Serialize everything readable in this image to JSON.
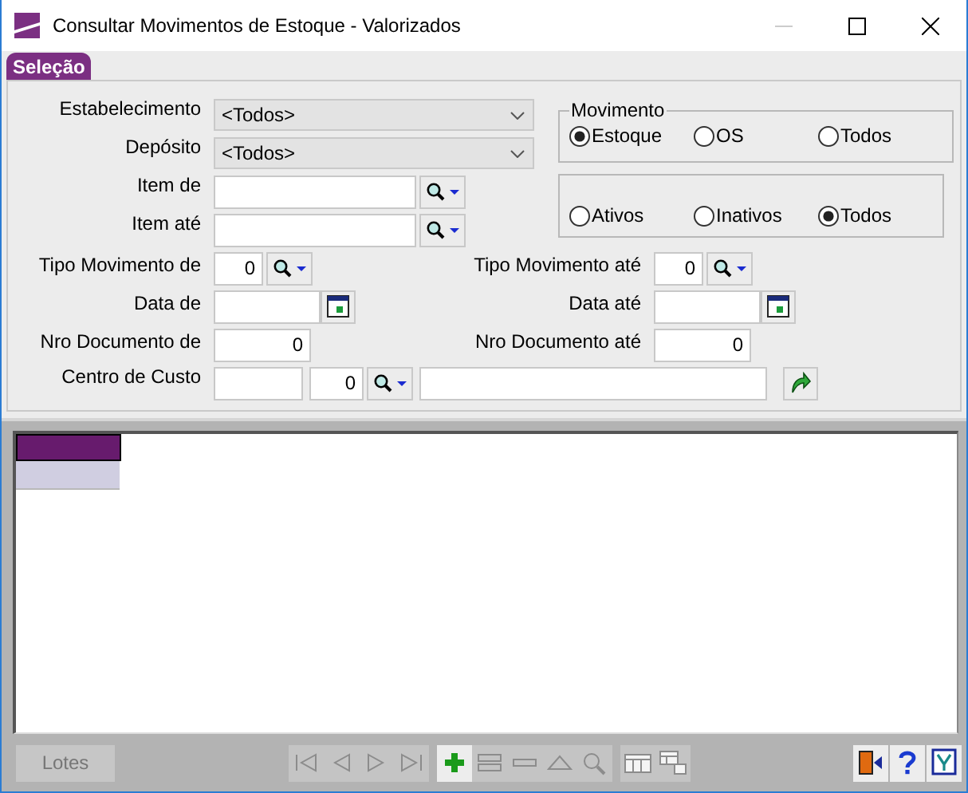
{
  "window": {
    "title": "Consultar Movimentos de Estoque - Valorizados",
    "minimize_disabled": true
  },
  "tabs": [
    {
      "label": "Seleção",
      "selected": true
    }
  ],
  "estabelecimento": {
    "label": "Estabelecimento",
    "value": "<Todos>"
  },
  "deposito": {
    "label": "Depósito",
    "value": "<Todos>"
  },
  "item_de": {
    "label": "Item de"
  },
  "item_ate": {
    "label": "Item até"
  },
  "movimento": {
    "legend": "Movimento",
    "options": [
      {
        "label": "Estoque",
        "selected": true
      },
      {
        "label": "OS",
        "selected": false
      },
      {
        "label": "Todos",
        "selected": false
      }
    ]
  },
  "situacao": {
    "options": [
      {
        "label": "Ativos",
        "selected": false
      },
      {
        "label": "Inativos",
        "selected": false
      },
      {
        "label": "Todos",
        "selected": true
      }
    ]
  },
  "tipo_movimento_de": {
    "label": "Tipo Movimento de",
    "value": "0"
  },
  "tipo_movimento_ate": {
    "label": "Tipo Movimento até",
    "value": "0"
  },
  "data_de": {
    "label": "Data de"
  },
  "data_ate": {
    "label": "Data até"
  },
  "nro_documento_de": {
    "label": "Nro Documento de",
    "value": "0"
  },
  "nro_documento_ate": {
    "label": "Nro Documento até",
    "value": "0"
  },
  "centro_de_custo": {
    "label": "Centro de Custo",
    "number": "0"
  },
  "lotes_button": {
    "label": "Lotes",
    "disabled": true
  },
  "toolbar": [
    {
      "kind": "first",
      "disabled": true
    },
    {
      "kind": "prev",
      "disabled": true
    },
    {
      "kind": "next",
      "disabled": true
    },
    {
      "kind": "last",
      "disabled": true
    },
    {
      "kind": "add",
      "disabled": false
    },
    {
      "kind": "edit",
      "disabled": true
    },
    {
      "kind": "delete",
      "disabled": true
    },
    {
      "kind": "up",
      "disabled": true
    },
    {
      "kind": "search",
      "disabled": true
    },
    {
      "kind": "grid",
      "disabled": true
    },
    {
      "kind": "export",
      "disabled": true
    }
  ]
}
